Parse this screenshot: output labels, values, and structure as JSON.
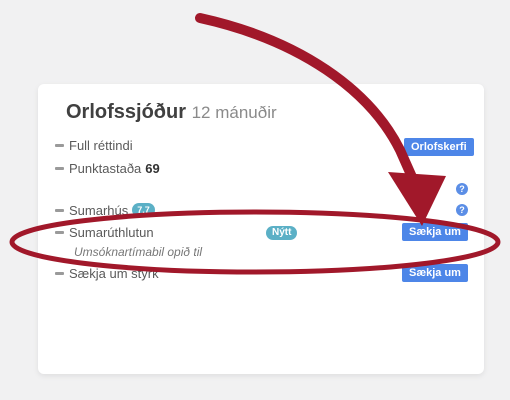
{
  "card": {
    "title": "Orlofssjóður",
    "subtitle": "12 mánuðir",
    "rows": [
      {
        "label": "Full réttindi"
      },
      {
        "label": "Punktastaða",
        "value": "69"
      },
      {
        "label": "Sumarhús",
        "badge": "7.7"
      },
      {
        "label": "Sumarúthlutun",
        "badge": "Nýtt",
        "note": "Umsóknartímabil opið til"
      },
      {
        "label": "Sækja um styrk"
      }
    ],
    "buttons": {
      "orlofskerfi": "Orlofskerfi",
      "saekja_um_1": "Sækja um",
      "saekja_um_2": "Sækja um"
    },
    "help": "?"
  },
  "annotation": {
    "color": "#a1182a"
  }
}
